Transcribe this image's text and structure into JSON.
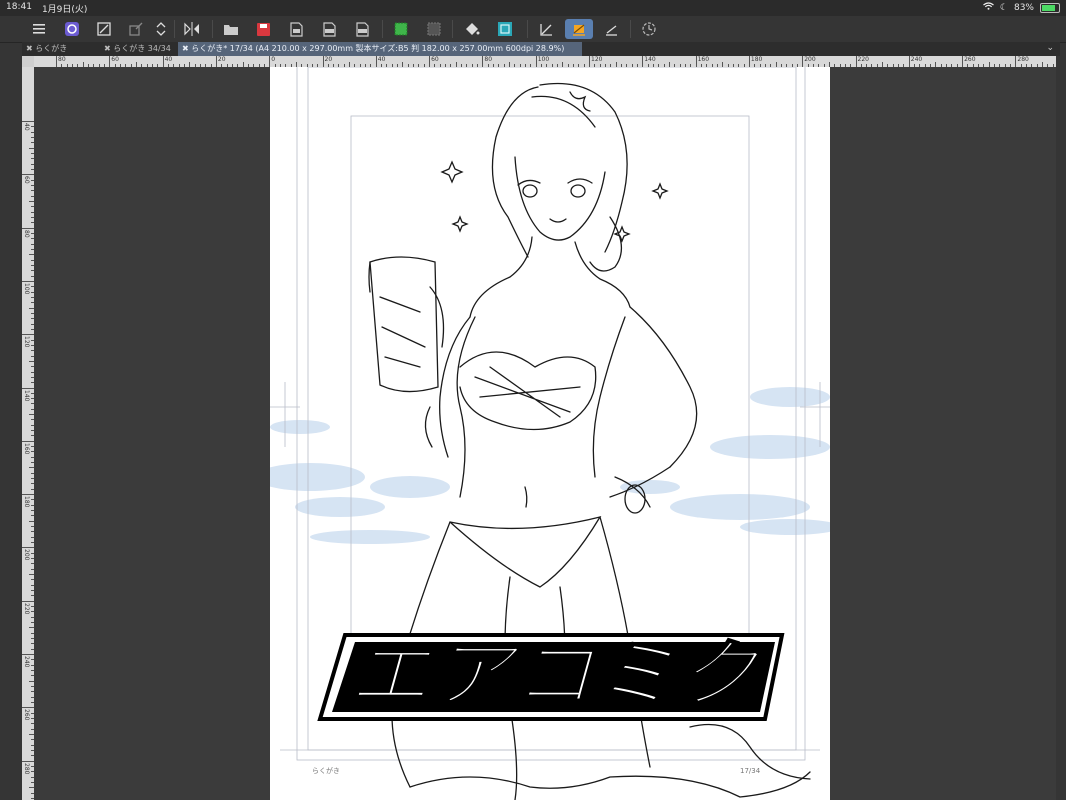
{
  "status": {
    "time": "18:41",
    "date": "1月9日(火)",
    "battery": "83%",
    "battery_level": 0.83
  },
  "toolbar": {
    "items": [
      {
        "name": "menu-button",
        "icon": "menu-icon"
      },
      {
        "name": "clip-studio-button",
        "icon": "clip-studio-icon"
      },
      {
        "name": "fit-canvas-button",
        "icon": "fit-canvas-icon"
      },
      {
        "name": "transform-button",
        "icon": "transform-icon"
      },
      {
        "name": "scroll-toggle-button",
        "icon": "up-down-icon"
      },
      {
        "name": "flip-button",
        "icon": "flip-horizontal-icon"
      },
      {
        "name": "open-button",
        "icon": "folder-icon"
      },
      {
        "name": "save-button",
        "icon": "save-icon"
      },
      {
        "name": "export-button",
        "icon": "export-icon"
      },
      {
        "name": "export-png-button",
        "icon": "export-png-icon"
      },
      {
        "name": "export-psd-button",
        "icon": "export-psd-icon"
      },
      {
        "name": "select-all-button",
        "icon": "select-all-icon"
      },
      {
        "name": "deselect-button",
        "icon": "deselect-icon"
      },
      {
        "name": "fill-button",
        "icon": "fill-bucket-icon"
      },
      {
        "name": "layer-color-button",
        "icon": "layer-color-icon"
      },
      {
        "name": "ruler-snap-button",
        "icon": "snap-ruler-icon"
      },
      {
        "name": "snap-special-button",
        "icon": "snap-special-icon"
      },
      {
        "name": "snap-grid-button",
        "icon": "snap-grid-icon"
      },
      {
        "name": "time-lapse-button",
        "icon": "time-lapse-icon"
      }
    ]
  },
  "tabs": [
    {
      "label": "らくがき"
    },
    {
      "label": "らくがき 34/34"
    },
    {
      "label": "らくがき* 17/34 (A4 210.00 x 297.00mm 製本サイズ:B5 判 182.00 x 257.00mm 600dpi 28.9%)"
    }
  ],
  "ruler": {
    "top_labels": [
      "80",
      "60",
      "40",
      "20",
      "0",
      "20",
      "40",
      "60",
      "80",
      "100",
      "120",
      "140",
      "160",
      "180",
      "200",
      "220",
      "240",
      "260",
      "280"
    ],
    "left_labels": [
      "40",
      "60",
      "80",
      "100",
      "120",
      "140",
      "160",
      "180",
      "200",
      "220",
      "240",
      "260",
      "280"
    ]
  },
  "canvas": {
    "logo_text": "エアコミク",
    "margin_left_label": "らくがき",
    "margin_right_label": "17/34"
  }
}
